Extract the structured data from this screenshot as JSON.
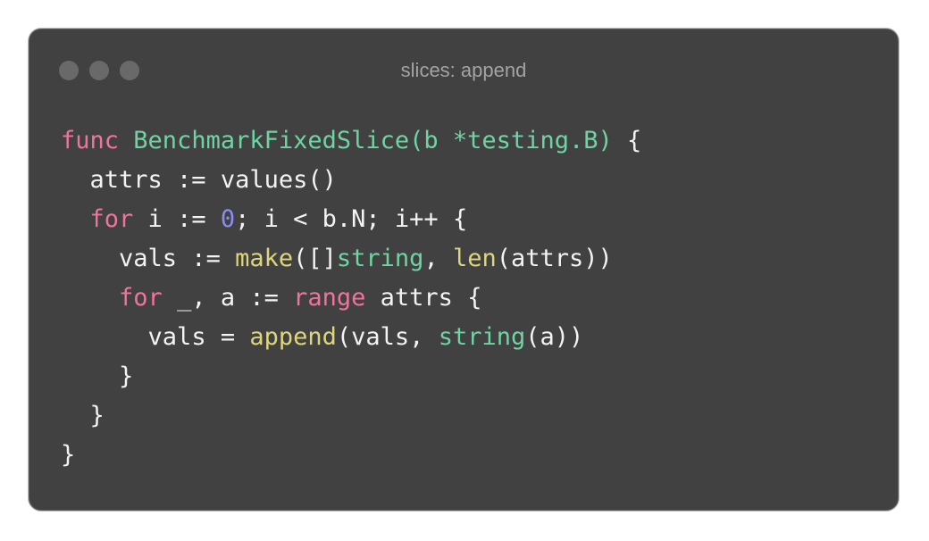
{
  "window": {
    "title": "slices: append"
  },
  "code": {
    "lines": [
      {
        "indent": "",
        "tokens": [
          {
            "t": "func",
            "c": "kw"
          },
          {
            "t": " ",
            "c": ""
          },
          {
            "t": "BenchmarkFixedSlice(b *testing.B)",
            "c": "fn"
          },
          {
            "t": " {",
            "c": ""
          }
        ]
      },
      {
        "indent": "  ",
        "tokens": [
          {
            "t": "attrs := values()",
            "c": ""
          }
        ]
      },
      {
        "indent": "  ",
        "tokens": [
          {
            "t": "for",
            "c": "kw"
          },
          {
            "t": " i := ",
            "c": ""
          },
          {
            "t": "0",
            "c": "num"
          },
          {
            "t": "; i < b.N; i++ {",
            "c": ""
          }
        ]
      },
      {
        "indent": "    ",
        "tokens": [
          {
            "t": "vals := ",
            "c": ""
          },
          {
            "t": "make",
            "c": "bi"
          },
          {
            "t": "([]",
            "c": ""
          },
          {
            "t": "string",
            "c": "ty"
          },
          {
            "t": ", ",
            "c": ""
          },
          {
            "t": "len",
            "c": "bi"
          },
          {
            "t": "(attrs))",
            "c": ""
          }
        ]
      },
      {
        "indent": "    ",
        "tokens": [
          {
            "t": "for",
            "c": "kw"
          },
          {
            "t": " _, a := ",
            "c": ""
          },
          {
            "t": "range",
            "c": "kw"
          },
          {
            "t": " attrs {",
            "c": ""
          }
        ]
      },
      {
        "indent": "      ",
        "tokens": [
          {
            "t": "vals = ",
            "c": ""
          },
          {
            "t": "append",
            "c": "bi"
          },
          {
            "t": "(vals, ",
            "c": ""
          },
          {
            "t": "string",
            "c": "ty"
          },
          {
            "t": "(a))",
            "c": ""
          }
        ]
      },
      {
        "indent": "    ",
        "tokens": [
          {
            "t": "}",
            "c": ""
          }
        ]
      },
      {
        "indent": "  ",
        "tokens": [
          {
            "t": "}",
            "c": ""
          }
        ]
      },
      {
        "indent": "",
        "tokens": [
          {
            "t": "}",
            "c": ""
          }
        ]
      }
    ]
  }
}
